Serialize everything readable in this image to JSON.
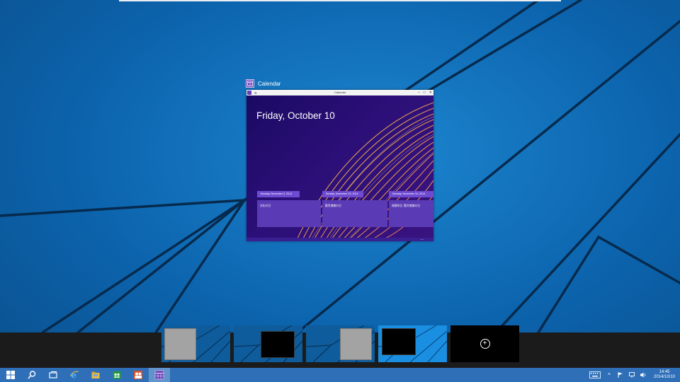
{
  "task_view": {
    "window_label": "Calendar",
    "window": {
      "title": "Calendar",
      "date_heading": "Friday, October 10",
      "events": [
        {
          "date": "Monday, November 3, 2014",
          "title": "文化の日"
        },
        {
          "date": "Sunday, November 23, 2014",
          "title": "勤労感謝の日"
        },
        {
          "date": "Monday, November 24, 2014",
          "title": "振替休日: 勤労感謝の日"
        }
      ],
      "more": "..."
    }
  },
  "desktops": {
    "items": [
      {
        "name": "desktop-1"
      },
      {
        "name": "desktop-2"
      },
      {
        "name": "desktop-3"
      },
      {
        "name": "desktop-4"
      }
    ],
    "add_label": "+"
  },
  "taskbar": {
    "icons": [
      "windows-logo-icon",
      "search-icon",
      "task-view-icon",
      "internet-explorer-icon",
      "file-explorer-icon",
      "store-icon",
      "people-icon",
      "calendar-icon"
    ],
    "accent": "#2e6fb8"
  },
  "tray": {
    "time": "14:45",
    "date": "2014/10/10",
    "show_hidden": "^"
  },
  "colors": {
    "desktop": "#0c64ad",
    "calendar_accent": "#6a3fb8",
    "strip": "#1b1b1b"
  }
}
